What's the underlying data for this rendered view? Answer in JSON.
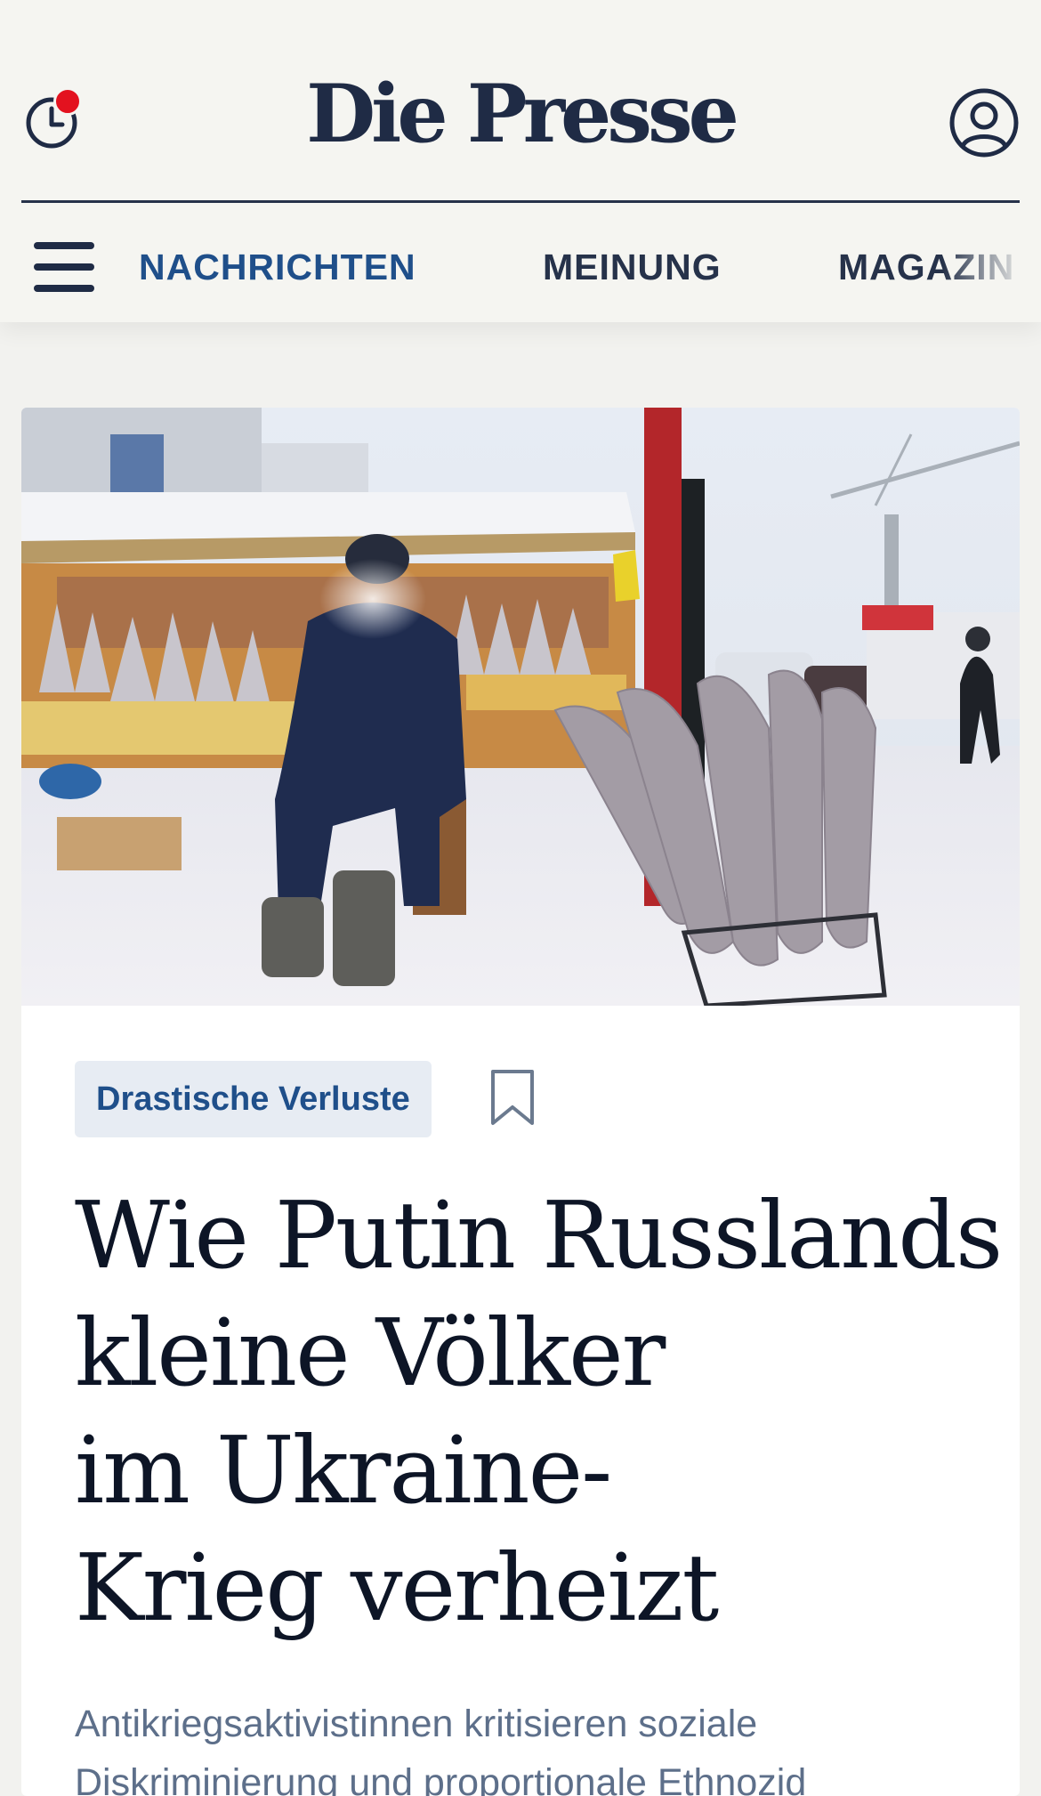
{
  "header": {
    "logo": "Die Presse",
    "history_icon": "clock-history-icon",
    "account_icon": "user-circle-icon",
    "notification_dot": true
  },
  "nav": {
    "menu_icon": "hamburger-menu-icon",
    "items": [
      {
        "label": "NACHRICHTEN",
        "active": true
      },
      {
        "label": "MEINUNG",
        "active": false
      },
      {
        "label": "MAGAZIN",
        "active": false
      }
    ]
  },
  "article": {
    "kicker": "Drastische Verluste",
    "bookmark_icon": "bookmark-icon",
    "headline_lines": [
      "Wie Putin Russlands",
      "kleine Völker",
      "im Ukraine-",
      "Krieg verheizt"
    ],
    "lead": "Antikriegsaktivistinnen kritisieren soziale Diskriminierung und proportionale Ethnozid"
  },
  "colors": {
    "brand_navy": "#1f2b45",
    "accent_blue": "#1f4f8a",
    "notification_red": "#e3121f",
    "lead_grey": "#5d6f8a"
  }
}
